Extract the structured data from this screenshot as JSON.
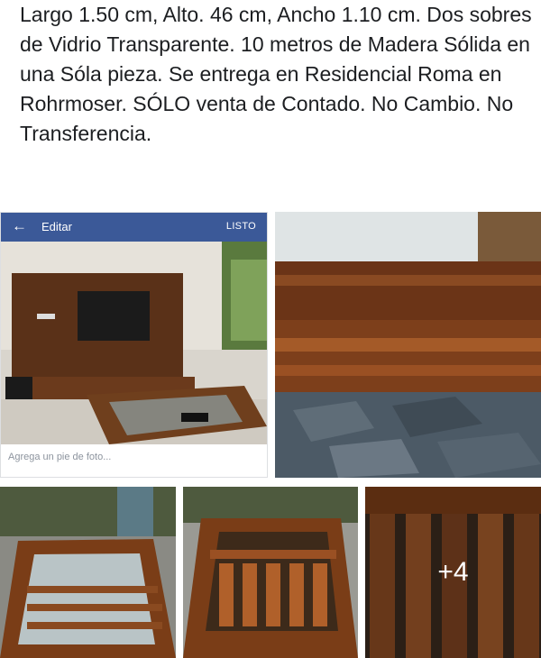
{
  "post": {
    "text": "Largo 1.50 cm, Alto. 46 cm, Ancho 1.10 cm. Dos sobres de Vidrio Transparente. 10 metros de Madera Sólida en una Sóla pieza. Se entrega en Residencial Roma en Rohrmoser. SÓLO venta de Contado. No Cambio. No Transferencia."
  },
  "editor": {
    "back_icon": "arrow-left-icon",
    "title": "Editar",
    "done_label": "LISTO",
    "caption_placeholder": "Agrega un pie de foto...",
    "bar_color": "#3b5998"
  },
  "gallery": {
    "more_count": "+4"
  }
}
